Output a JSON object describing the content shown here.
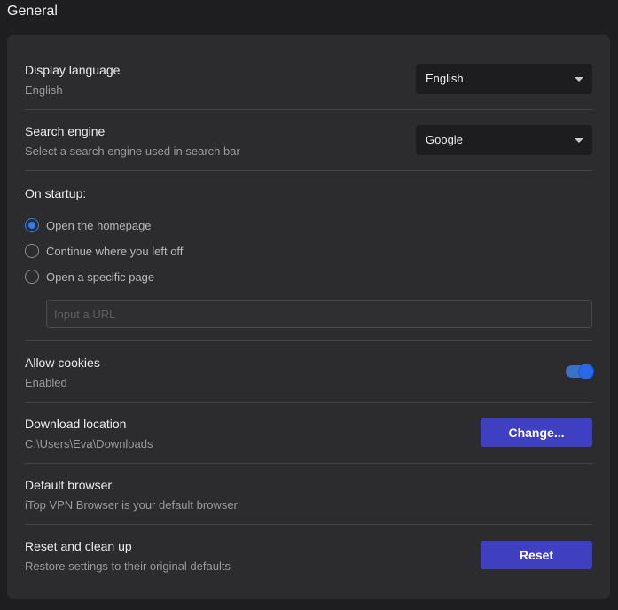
{
  "page": {
    "title": "General"
  },
  "display_language": {
    "title": "Display language",
    "subtitle": "English",
    "selected": "English"
  },
  "search_engine": {
    "title": "Search engine",
    "subtitle": "Select a search engine used in search bar",
    "selected": "Google"
  },
  "startup": {
    "title": "On startup:",
    "options": [
      {
        "label": "Open the homepage",
        "checked": true
      },
      {
        "label": "Continue where you left off",
        "checked": false
      },
      {
        "label": "Open a specific page",
        "checked": false
      }
    ],
    "url_placeholder": "Input a URL",
    "url_value": ""
  },
  "cookies": {
    "title": "Allow cookies",
    "subtitle": "Enabled",
    "enabled": true
  },
  "download": {
    "title": "Download location",
    "subtitle": "C:\\Users\\Eva\\Downloads",
    "button_label": "Change..."
  },
  "default_browser": {
    "title": "Default browser",
    "subtitle": "iTop VPN Browser is your default browser"
  },
  "reset": {
    "title": "Reset and clean up",
    "subtitle": "Restore settings to their original defaults",
    "button_label": "Reset"
  },
  "colors": {
    "accent_button": "#3f3fc2",
    "radio_checked": "#2f7cf6",
    "toggle_on": "#2a68e8",
    "panel_bg": "#2c2c2e",
    "page_bg": "#1e1e21"
  }
}
